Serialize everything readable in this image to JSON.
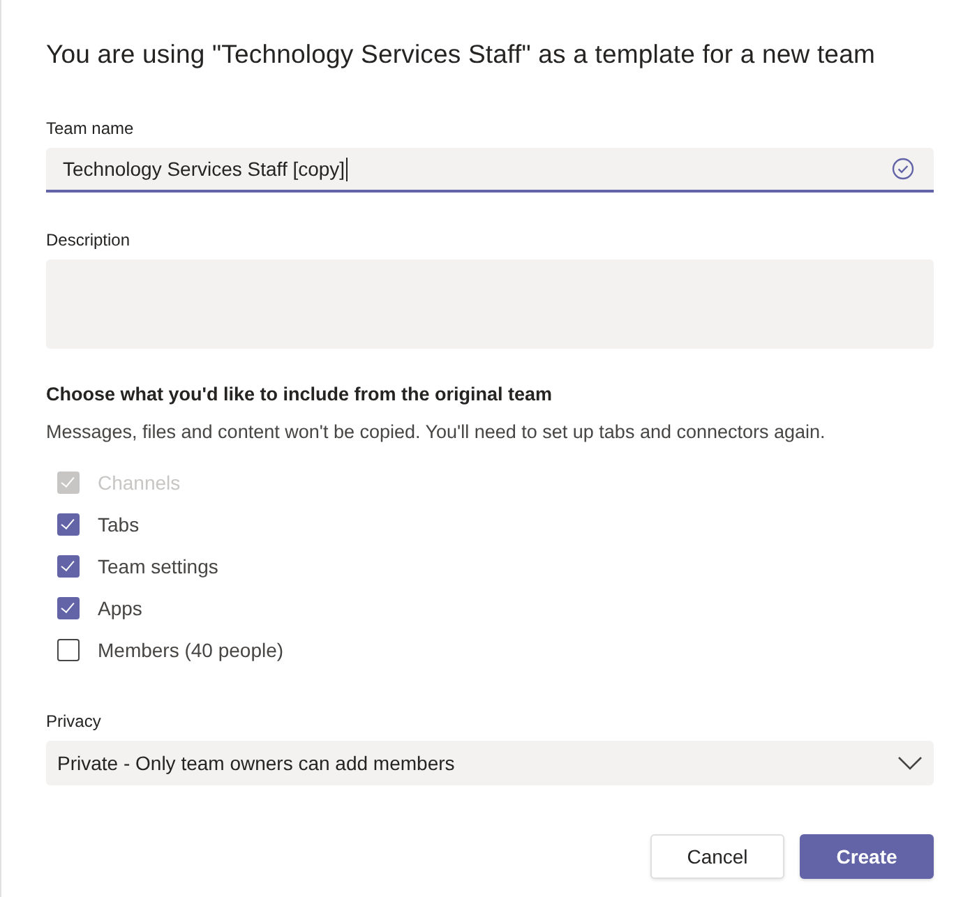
{
  "dialog": {
    "title": "You are using \"Technology Services Staff\" as a template for a new team"
  },
  "team_name": {
    "label": "Team name",
    "value": "Technology Services Staff [copy]",
    "focused": true,
    "valid": true
  },
  "description": {
    "label": "Description"
  },
  "include": {
    "heading": "Choose what you'd like to include from the original team",
    "note": "Messages, files and content won't be copied. You'll need to set up tabs and connectors again.",
    "options": [
      {
        "label": "Channels",
        "checked": true,
        "disabled": true
      },
      {
        "label": "Tabs",
        "checked": true,
        "disabled": false
      },
      {
        "label": "Team settings",
        "checked": true,
        "disabled": false
      },
      {
        "label": "Apps",
        "checked": true,
        "disabled": false
      },
      {
        "label": "Members (40 people)",
        "checked": false,
        "disabled": false
      }
    ]
  },
  "privacy": {
    "label": "Privacy",
    "value": "Private - Only team owners can add members"
  },
  "buttons": [
    {
      "label": "Cancel",
      "kind": "secondary"
    },
    {
      "label": "Create",
      "kind": "primary"
    }
  ]
}
